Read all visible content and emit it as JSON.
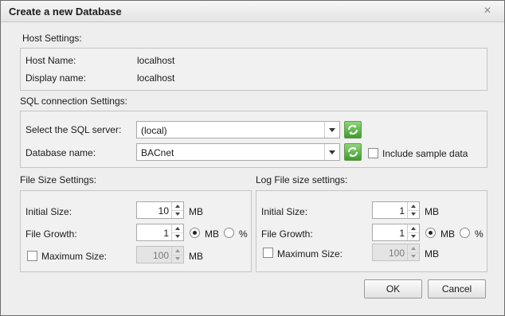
{
  "dialog": {
    "title": "Create a new Database",
    "close_glyph": "✕"
  },
  "host": {
    "section_label": "Host Settings:",
    "host_name_label": "Host Name:",
    "host_name_value": "localhost",
    "display_name_label": "Display name:",
    "display_name_value": "localhost"
  },
  "sql": {
    "section_label": "SQL connection Settings:",
    "server_label": "Select the SQL server:",
    "server_value": "(local)",
    "db_label": "Database name:",
    "db_value": "BACnet",
    "include_sample_label": "Include sample data",
    "include_sample_checked": false
  },
  "file_size": {
    "section_label": "File Size Settings:",
    "initial_label": "Initial Size:",
    "initial_value": "10",
    "initial_unit": "MB",
    "growth_label": "File Growth:",
    "growth_value": "1",
    "growth_mb": "MB",
    "growth_pct": "%",
    "growth_selected": "MB",
    "max_label": "Maximum Size:",
    "max_value": "100",
    "max_unit": "MB",
    "max_checked": false
  },
  "log_size": {
    "section_label": "Log File size settings:",
    "initial_label": "Initial Size:",
    "initial_value": "1",
    "initial_unit": "MB",
    "growth_label": "File Growth:",
    "growth_value": "1",
    "growth_mb": "MB",
    "growth_pct": "%",
    "growth_selected": "MB",
    "max_label": "Maximum Size:",
    "max_value": "100",
    "max_unit": "MB",
    "max_checked": false
  },
  "buttons": {
    "ok": "OK",
    "cancel": "Cancel"
  },
  "icons": {
    "refresh": "refresh-icon",
    "close": "close-icon",
    "dropdown": "chevron-down-icon"
  },
  "colors": {
    "refresh_green": "#3f9b2c"
  }
}
